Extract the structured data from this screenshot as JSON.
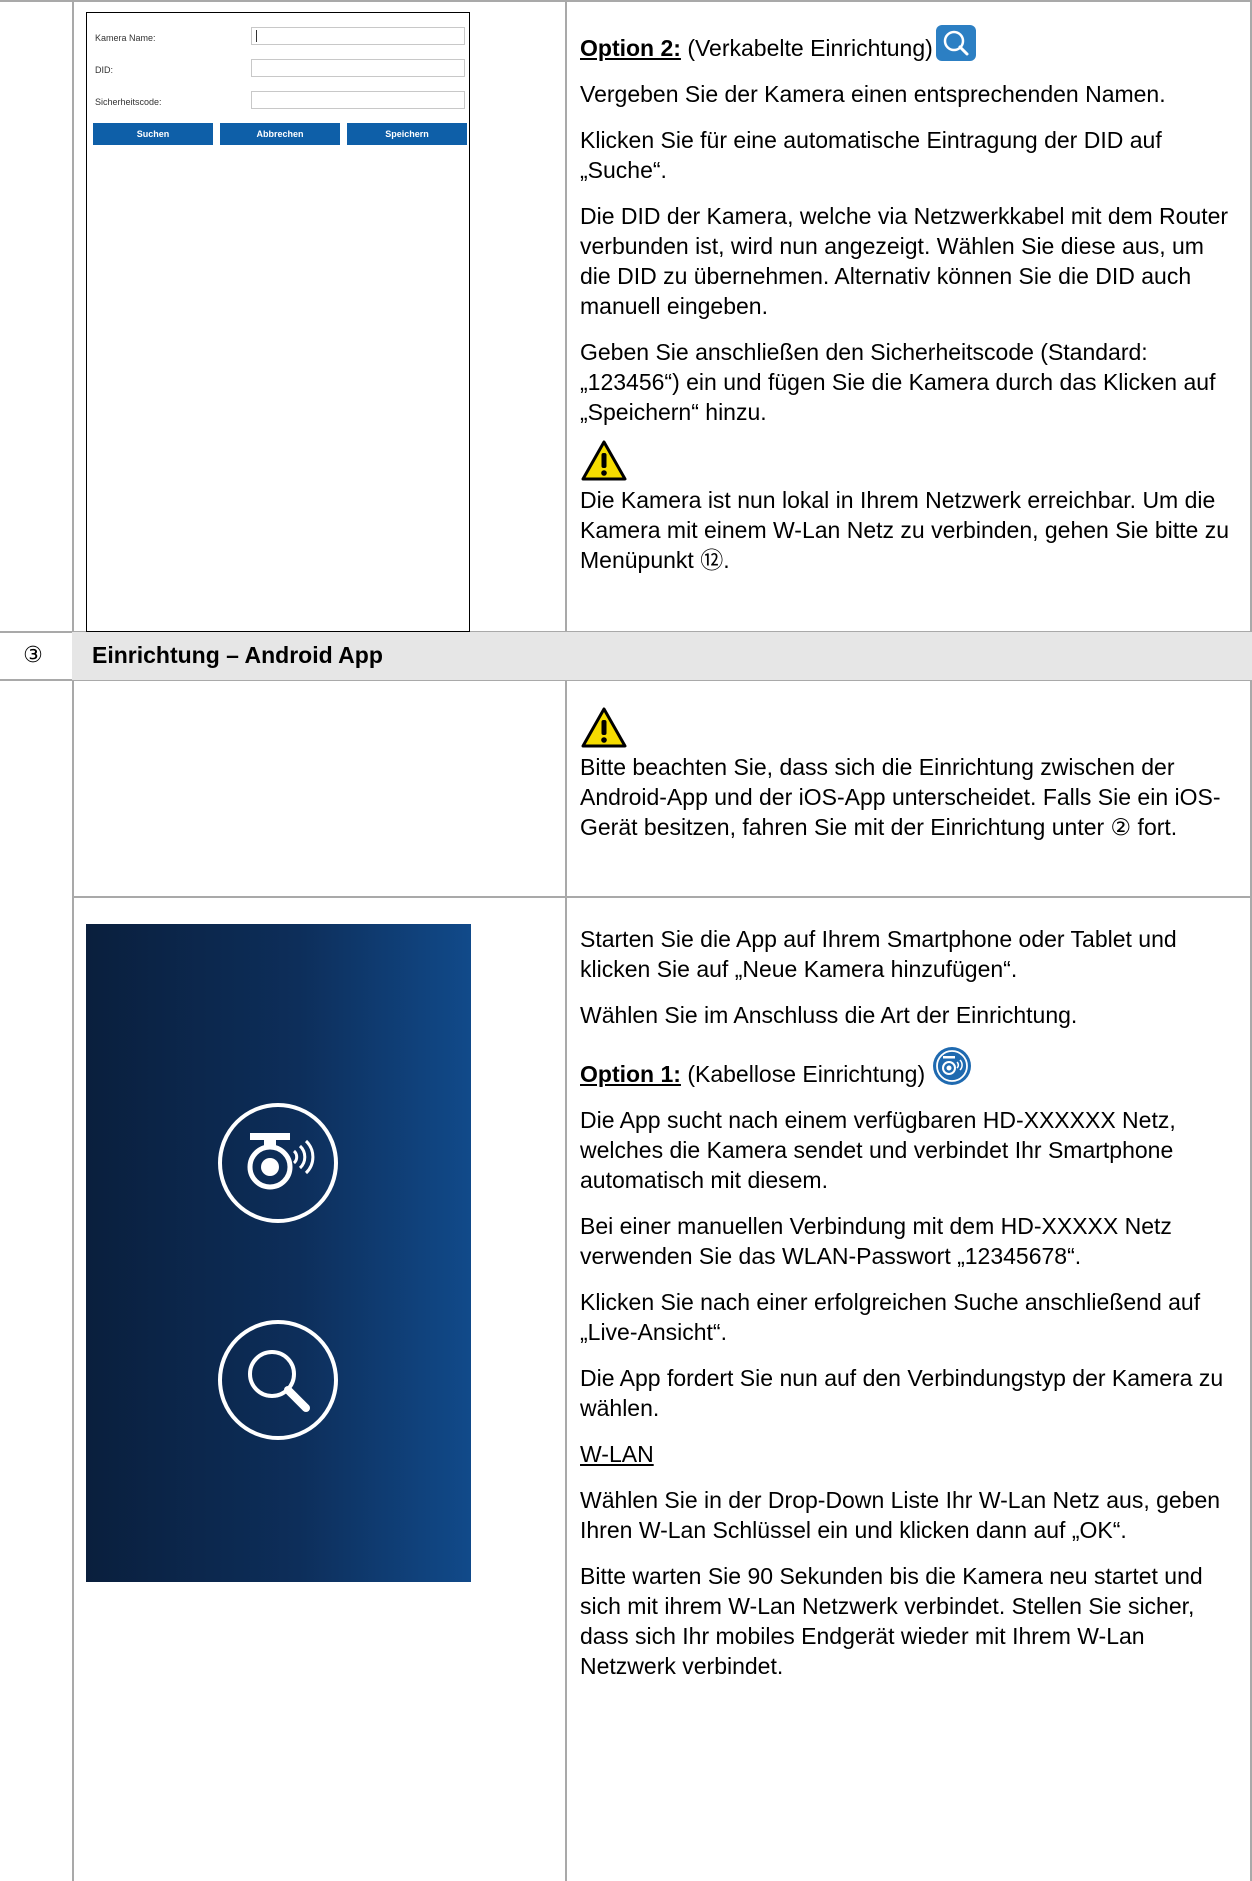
{
  "form_screenshot": {
    "fields": [
      {
        "label": "Kamera Name:"
      },
      {
        "label": "DID:"
      },
      {
        "label": "Sicherheitscode:"
      }
    ],
    "buttons": [
      "Suchen",
      "Abbrechen",
      "Speichern"
    ]
  },
  "option2": {
    "label": "Option 2:",
    "caption": "(Verkabelte Einrichtung)",
    "icon": "search-icon",
    "paragraphs": [
      "Vergeben Sie der Kamera einen entsprechenden Namen.",
      "Klicken Sie für eine automatische Eintragung der DID auf „Suche“.",
      "Die DID der Kamera, welche via Netzwerkkabel mit dem Router verbunden ist, wird nun angezeigt. Wählen Sie diese aus, um die DID zu übernehmen. Alternativ können Sie die DID auch manuell eingeben.",
      "Geben Sie anschließen den Sicherheitscode (Standard: „123456“) ein und fügen Sie die Kamera durch das Klicken auf „Speichern“ hinzu."
    ],
    "warning": "Die Kamera ist nun lokal in Ihrem Netzwerk erreichbar. Um die Kamera mit einem W-Lan Netz zu verbinden, gehen Sie bitte zu Menüpunkt ⑫."
  },
  "section": {
    "number": "③",
    "title": "Einrichtung – Android App"
  },
  "android_note": {
    "warning": "Bitte beachten Sie, dass sich die Einrichtung zwischen der Android-App und der iOS-App unterscheidet. Falls Sie ein iOS-Gerät besitzen, fahren Sie mit der Einrichtung unter ② fort."
  },
  "android_steps": {
    "intro": [
      "Starten Sie die App auf Ihrem Smartphone oder Tablet und klicken Sie auf „Neue Kamera hinzufügen“.",
      "Wählen Sie im Anschluss die Art der Einrichtung."
    ],
    "option1": {
      "label": "Option 1:",
      "caption": "(Kabellose Einrichtung)",
      "icon": "wireless-camera-icon"
    },
    "body": [
      "Die App sucht nach einem verfügbaren HD-XXXXXX Netz, welches die Kamera sendet und verbindet Ihr Smartphone automatisch mit diesem.",
      "Bei einer manuellen Verbindung mit dem HD-XXXXX Netz verwenden Sie das WLAN-Passwort „12345678“.",
      "Klicken Sie nach einer erfolgreichen Suche anschließend auf „Live-Ansicht“.",
      "Die App fordert Sie nun auf den Verbindungstyp der Kamera zu wählen."
    ],
    "wlan_heading": "W-LAN",
    "wlan_body": [
      "Wählen Sie in der Drop-Down Liste Ihr W-Lan Netz aus, geben Ihren W-Lan Schlüssel ein und klicken dann auf „OK“.",
      "Bitte warten Sie 90 Sekunden bis die Kamera neu startet und sich mit ihrem W-Lan Netzwerk verbindet. Stellen Sie sicher, dass sich Ihr mobiles Endgerät wieder mit Ihrem W-Lan Netzwerk verbindet."
    ]
  },
  "colors": {
    "app_blue_dark": "#0a1f3d",
    "app_blue_light": "#114a8a",
    "form_button_blue": "#0e5fa8",
    "warning_yellow": "#f5dc00"
  }
}
